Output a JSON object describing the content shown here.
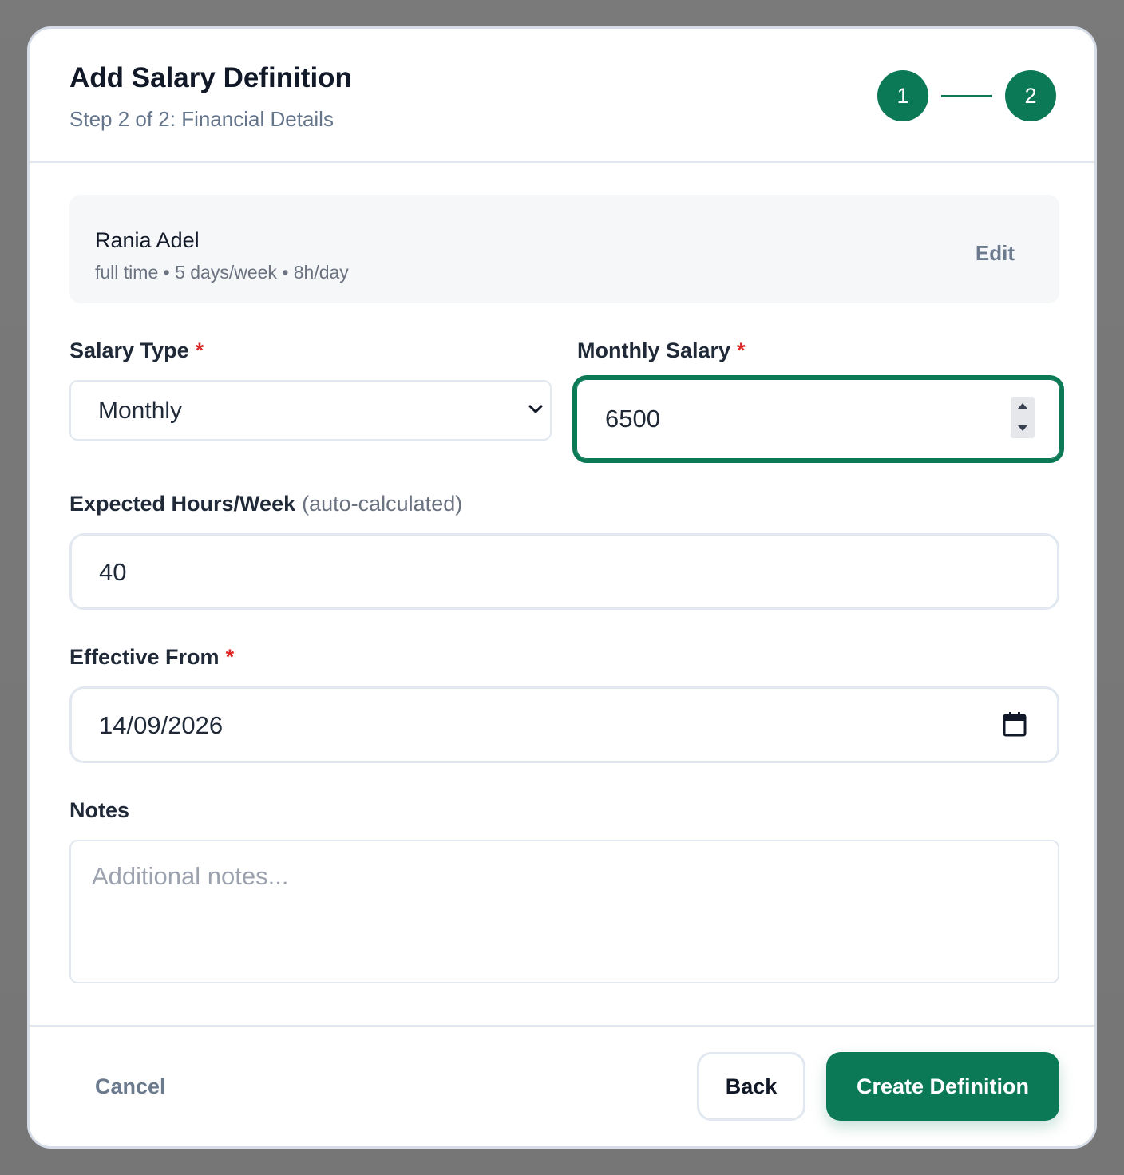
{
  "modal": {
    "title": "Add Salary Definition",
    "subtitle": "Step 2 of 2: Financial Details",
    "steps": [
      "1",
      "2"
    ]
  },
  "employee": {
    "name": "Rania Adel",
    "meta": "full time • 5 days/week • 8h/day",
    "edit_label": "Edit"
  },
  "salary_type": {
    "label": "Salary Type",
    "required_mark": "*",
    "value": "Monthly"
  },
  "monthly_salary": {
    "label": "Monthly Salary",
    "required_mark": "*",
    "value": "6500"
  },
  "expected_hours": {
    "label": "Expected Hours/Week",
    "hint": "(auto-calculated)",
    "value": "40"
  },
  "effective_from": {
    "label": "Effective From",
    "required_mark": "*",
    "value": "14/09/2026"
  },
  "notes": {
    "label": "Notes",
    "placeholder": "Additional notes..."
  },
  "footer": {
    "cancel_label": "Cancel",
    "back_label": "Back",
    "create_label": "Create Definition"
  },
  "colors": {
    "accent": "#0b7856",
    "required": "#dc2626",
    "muted_text": "#6b7280"
  },
  "icons": {
    "select_chevron": "chevron-down-icon",
    "number_spinner": "spinner-arrows-icon",
    "date_picker": "calendar-icon"
  }
}
